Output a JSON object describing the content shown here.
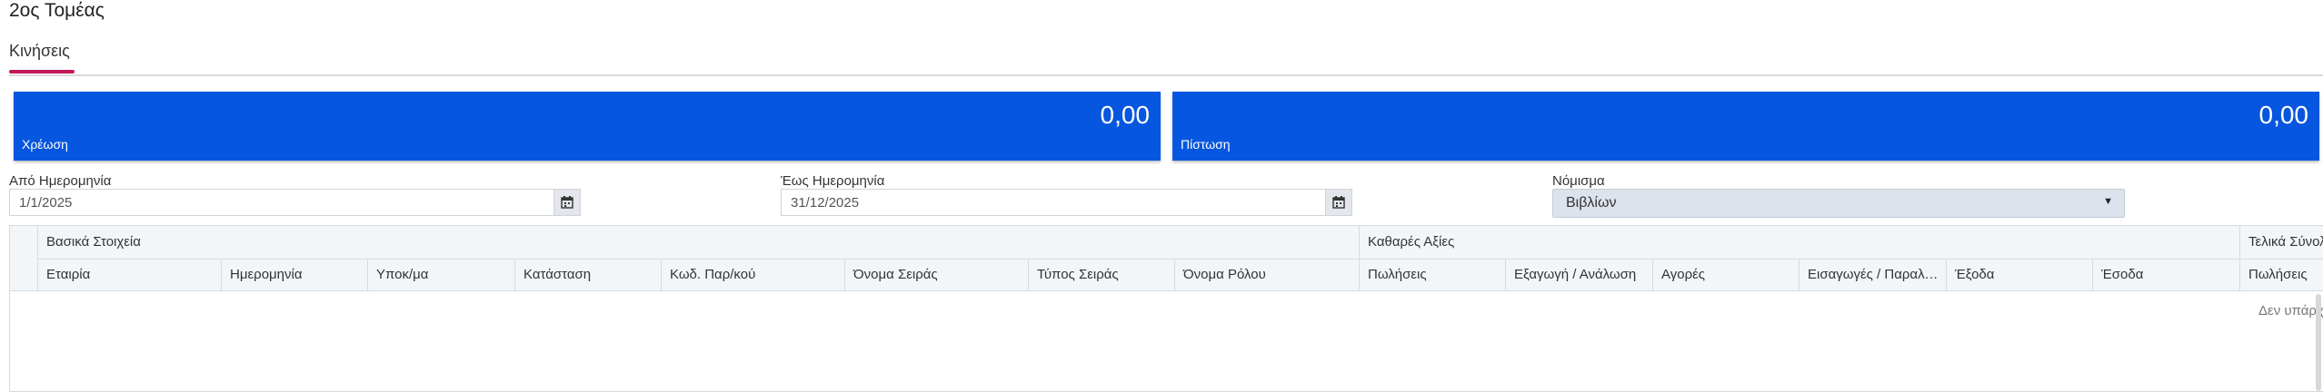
{
  "page": {
    "title": "2ος Τομέας"
  },
  "tabs": [
    {
      "label": "Κινήσεις",
      "active": true
    }
  ],
  "summary": {
    "debit": {
      "value": "0,00",
      "label": "Χρέωση"
    },
    "credit": {
      "value": "0,00",
      "label": "Πίστωση"
    },
    "card_color": "#0756e0"
  },
  "filters": {
    "from_date": {
      "label": "Από Ημερομηνία",
      "value": "1/1/2025"
    },
    "to_date": {
      "label": "Έως Ημερομηνία",
      "value": "31/12/2025"
    },
    "currency": {
      "label": "Νόμισμα",
      "value": "Βιβλίων"
    }
  },
  "grid": {
    "groups": [
      "Βασικά Στοιχεία",
      "Καθαρές Αξίες",
      "Τελικά Σύνολα"
    ],
    "columns": [
      "Εταιρία",
      "Ημερομηνία",
      "Υποκ/μα",
      "Κατάσταση",
      "Κωδ. Παρ/κού",
      "Όνομα Σειράς",
      "Τύπος Σειράς",
      "Όνομα Ρόλου",
      "Πωλήσεις",
      "Εξαγωγή / Ανάλωση",
      "Αγορές",
      "Εισαγωγές / Παραλαβές",
      "Έξοδα",
      "Έσοδα",
      "Πωλήσεις"
    ],
    "empty_message": "Δεν υπάρχουν εγγραφές"
  },
  "accent_color": "#c2185b"
}
